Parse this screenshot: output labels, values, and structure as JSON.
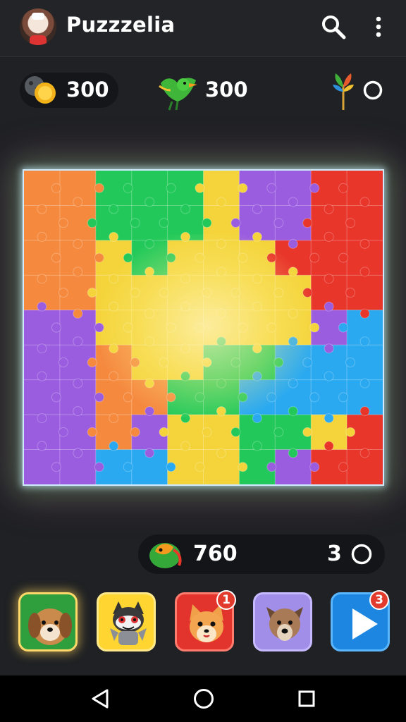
{
  "app": {
    "title": "Puzzzelia"
  },
  "header_icons": {
    "search": "search-icon",
    "menu": "more-vert-icon"
  },
  "currencies": [
    {
      "icon": "coin-icon",
      "value": "300"
    },
    {
      "icon": "green-bird-icon",
      "value": "300"
    },
    {
      "icon": "plant-sprout-icon",
      "value": ""
    }
  ],
  "board": {
    "rows": 9,
    "cols": 10,
    "palette": {
      "R": "#f2533d",
      "O": "#f58a3f",
      "G": "#22c95a",
      "Y": "#f4d43a",
      "P": "#9b5de0",
      "B": "#2aa9f0",
      "D": "#e8362b"
    },
    "grid": [
      "OOGGGYPPDD",
      "OOGGGYPPDD",
      "OOYGYYYDDD",
      "OOYYYYYYDD",
      "PPYYYYYYPB",
      "PPOYYGGBBB",
      "PPOOGGBBBB",
      "PPOPYYGGYD",
      "PPBBYYGPDD"
    ]
  },
  "status": {
    "score": "760",
    "moves": "3"
  },
  "tiles": [
    {
      "name": "tile-shaggy-dog",
      "icon": "shaggy-dog-icon",
      "badge": ""
    },
    {
      "name": "tile-raccoon-cat",
      "icon": "raccoon-cat-icon",
      "badge": ""
    },
    {
      "name": "tile-fox",
      "icon": "fox-icon",
      "badge": "1"
    },
    {
      "name": "tile-brown-dog",
      "icon": "brown-dog-icon",
      "badge": ""
    },
    {
      "name": "tile-play",
      "icon": "play-icon",
      "badge": "3"
    }
  ],
  "navbar": {
    "back": "back-icon",
    "home": "home-icon",
    "recent": "recent-apps-icon"
  }
}
